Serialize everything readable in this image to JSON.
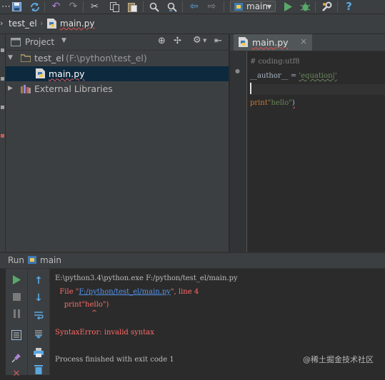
{
  "toolbar": {
    "icons": [
      "floppy-icon",
      "sync-icon",
      "undo-icon",
      "redo-icon",
      "cut-icon",
      "copy-icon",
      "paste-icon",
      "find-icon",
      "replace-icon",
      "back-icon",
      "forward-icon",
      "run-icon",
      "debug-icon",
      "wrench-icon",
      "help-icon"
    ],
    "run_config_label": "main",
    "help_label": "?"
  },
  "breadcrumb": {
    "project": "test_el",
    "file": "main.py"
  },
  "project_panel": {
    "title": "Project",
    "tree": [
      {
        "label": "test_el",
        "path": "(F:\\python\\test_el)",
        "expanded": true
      },
      {
        "label": "main.py",
        "selected": true
      },
      {
        "label": "External Libraries",
        "expanded": false
      }
    ]
  },
  "editor": {
    "tab_label": "main.py",
    "lines": [
      "# coding:utf8",
      "__author__ = 'equation|'",
      "",
      "print\"hello\")"
    ]
  },
  "run_panel": {
    "title_prefix": "Run",
    "title": "main",
    "console": [
      "E:\\python3.4\\python.exe F:/python/test_el/main.py",
      "  File \"F:/python/test_el/main.py\", line 4",
      "    print\"hello\")",
      "                ^",
      "SyntaxError: invalid syntax",
      "Process finished with exit code 1"
    ]
  },
  "watermark": "@稀土掘金技术社区",
  "colors": {
    "bg": "#2b2b2b",
    "panel": "#3c3f41",
    "selection": "#0d293e",
    "error": "#ff6b68",
    "link": "#5394ec",
    "comment": "#808080",
    "string": "#6a8759",
    "keyword": "#cc7832",
    "run_green": "#59a869"
  }
}
